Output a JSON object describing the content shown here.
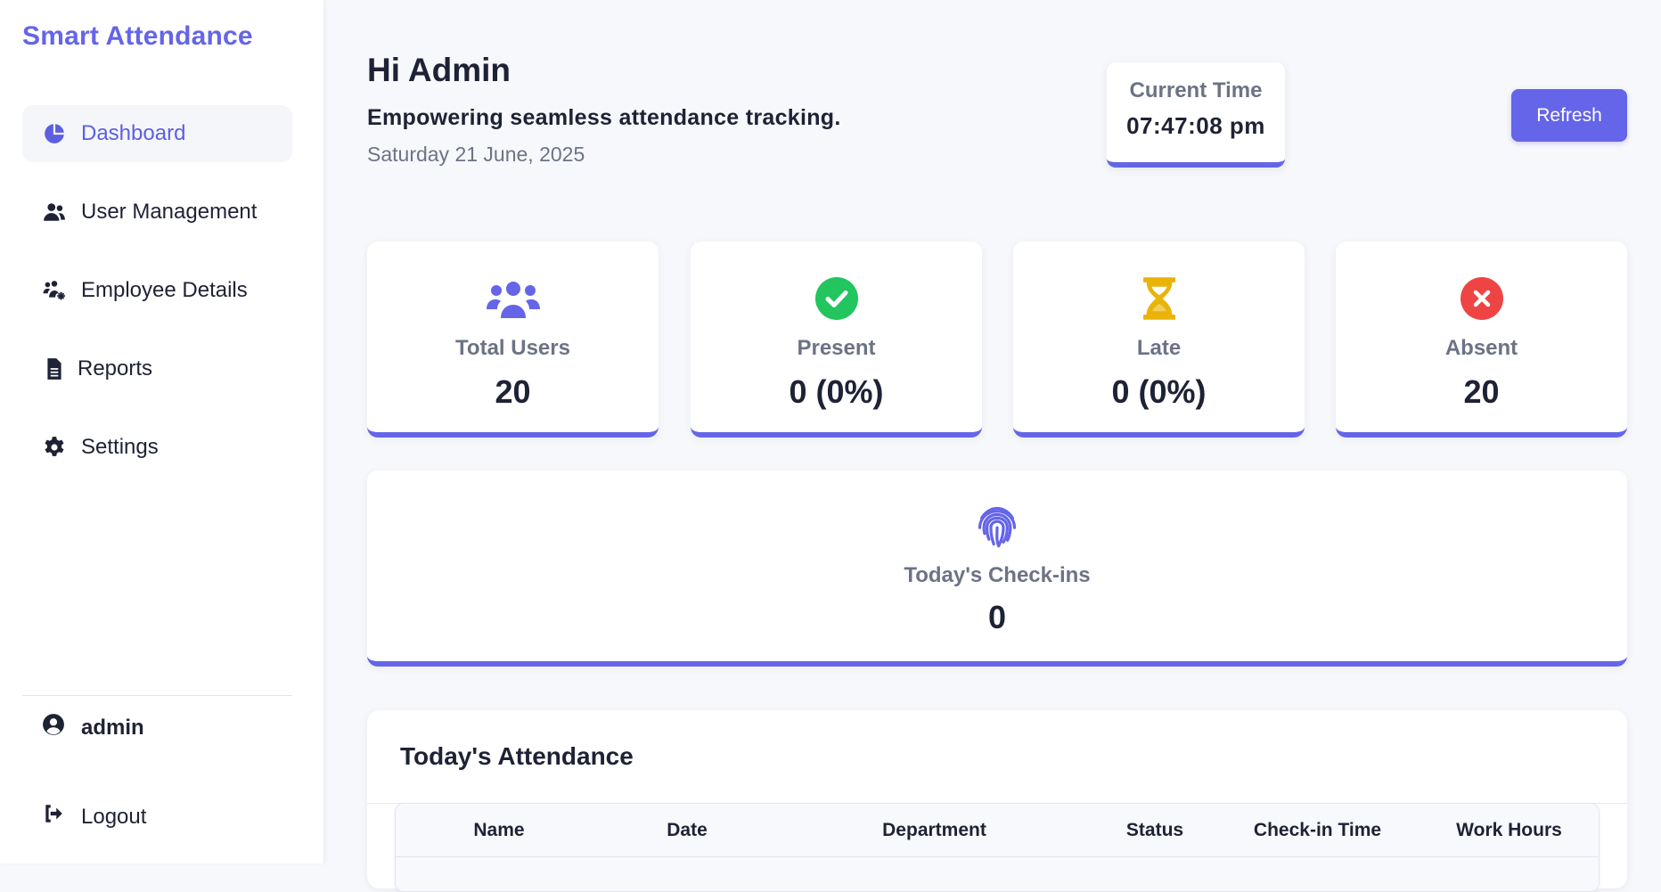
{
  "brand": "Smart Attendance",
  "sidebar": {
    "items": [
      {
        "label": "Dashboard",
        "icon": "pie-chart-icon"
      },
      {
        "label": "User Management",
        "icon": "users-icon"
      },
      {
        "label": "Employee Details",
        "icon": "users-cog-icon"
      },
      {
        "label": "Reports",
        "icon": "file-icon"
      },
      {
        "label": "Settings",
        "icon": "gear-icon"
      }
    ],
    "user": "admin",
    "logout": "Logout"
  },
  "header": {
    "greeting": "Hi Admin",
    "tagline": "Empowering seamless attendance tracking.",
    "date": "Saturday 21 June, 2025"
  },
  "time_card": {
    "label": "Current Time",
    "value": "07:47:08 pm"
  },
  "refresh_label": "Refresh",
  "stats": [
    {
      "label": "Total Users",
      "value": "20",
      "icon": "users-icon",
      "color": "#6465e8"
    },
    {
      "label": "Present",
      "value": "0 (0%)",
      "icon": "check-circle-icon",
      "color": "#22c55e"
    },
    {
      "label": "Late",
      "value": "0 (0%)",
      "icon": "hourglass-icon",
      "color": "#eab308"
    },
    {
      "label": "Absent",
      "value": "20",
      "icon": "x-circle-icon",
      "color": "#ef4444"
    }
  ],
  "checkins": {
    "label": "Today's Check-ins",
    "value": "0",
    "icon": "fingerprint-icon"
  },
  "attendance": {
    "title": "Today's Attendance",
    "columns": [
      "Name",
      "Date",
      "Department",
      "Status",
      "Check-in Time",
      "Work Hours"
    ]
  },
  "colors": {
    "accent": "#6465e8"
  }
}
